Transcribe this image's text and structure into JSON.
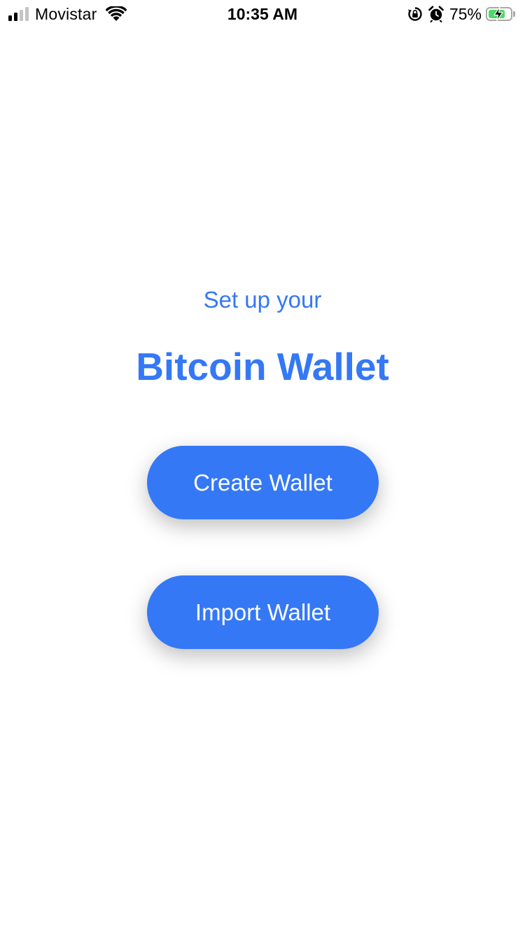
{
  "status_bar": {
    "carrier": "Movistar",
    "time": "10:35 AM",
    "battery_percent": "75%",
    "battery_level": 0.75,
    "signal_bars_active": 2,
    "signal_bars_total": 4,
    "icons": [
      "signal-icon",
      "wifi-icon",
      "orientation-lock-icon",
      "alarm-icon",
      "battery-icon",
      "charging-bolt-icon"
    ]
  },
  "setup": {
    "subtitle": "Set up your",
    "title": "Bitcoin Wallet"
  },
  "actions": {
    "create_label": "Create Wallet",
    "import_label": "Import Wallet"
  },
  "colors": {
    "accent": "#3478f6",
    "button_text": "#ffffff",
    "battery_fill": "#4cd964",
    "background": "#ffffff"
  }
}
